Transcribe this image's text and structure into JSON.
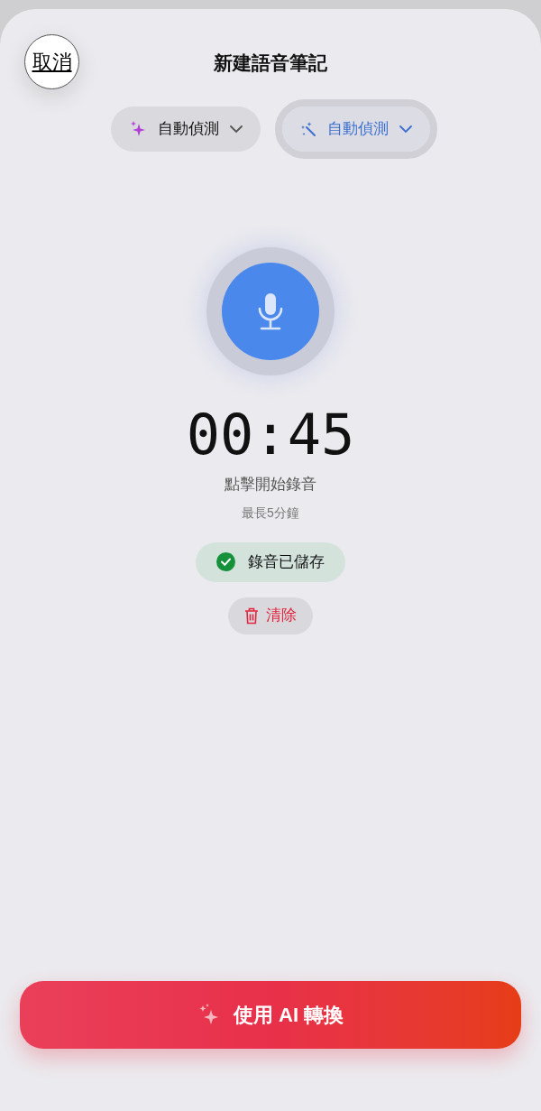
{
  "header": {
    "cancel": "取消",
    "title": "新建語音筆記"
  },
  "pickers": [
    {
      "label": "自動偵測",
      "kind": "sparkle",
      "selected": false
    },
    {
      "label": "自動偵測",
      "kind": "wand",
      "selected": true
    }
  ],
  "recorder": {
    "timer": "00:45",
    "hint": "點擊開始錄音",
    "limit": "最長5分鐘"
  },
  "saved_badge": "錄音已儲存",
  "clear_button": "清除",
  "convert_button": "使用 AI 轉換"
}
